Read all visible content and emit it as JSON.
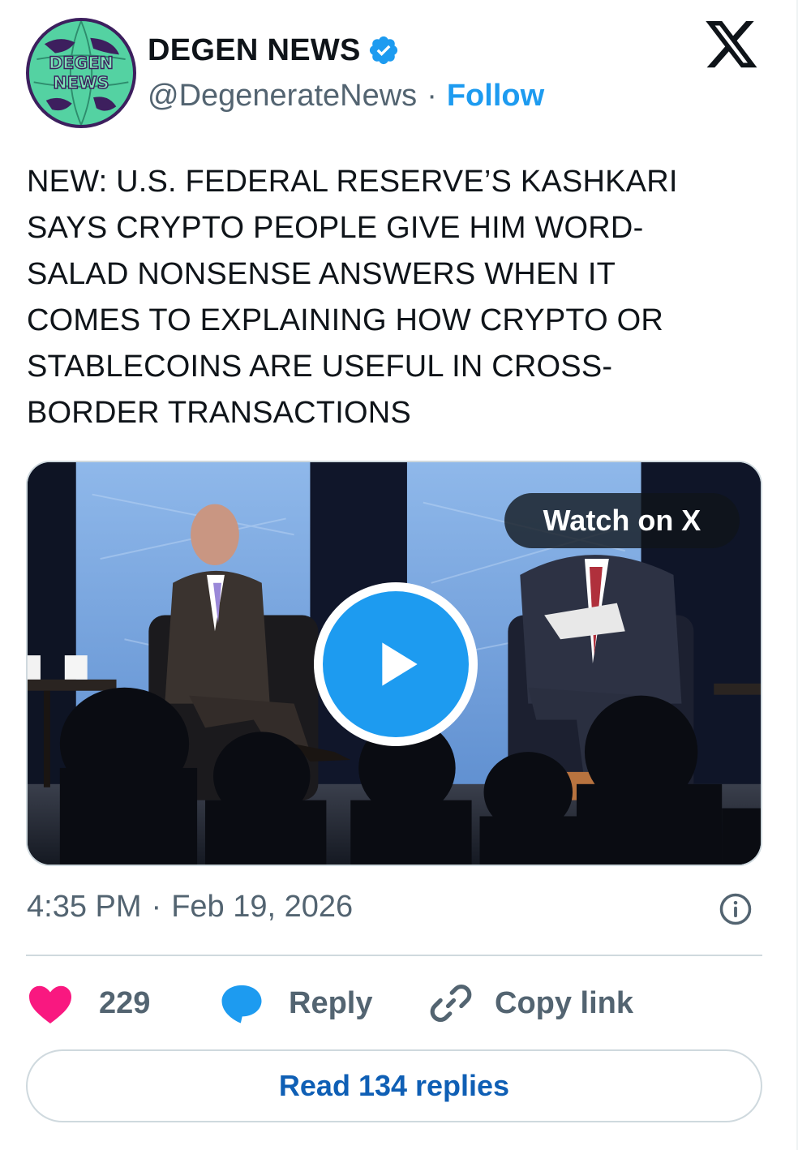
{
  "author": {
    "display_name": "DEGEN NEWS",
    "handle": "@DegenerateNews",
    "separator": "·",
    "follow_label": "Follow",
    "avatar_text_line1": "DEGEN",
    "avatar_text_line2": "NEWS",
    "verified": true
  },
  "tweet": {
    "text": "NEW: U.S. FEDERAL RESERVE’S KASHKARI SAYS CRYPTO PEOPLE GIVE HIM WORD-SALAD NONSENSE ANSWERS WHEN IT COMES TO EXPLAINING HOW CRYPTO OR STABLECOINS ARE USEFUL IN CROSS-BORDER TRANSACTIONS",
    "text_lines": [
      "NEW: U.S. FEDERAL RESERVE’S KASHKARI",
      "SAYS CRYPTO PEOPLE GIVE HIM WORD-",
      "SALAD NONSENSE ANSWERS WHEN IT",
      "COMES TO EXPLAINING HOW CRYPTO OR",
      "STABLECOINS ARE USEFUL IN CROSS-",
      "BORDER TRANSACTIONS"
    ]
  },
  "media": {
    "watch_label": "Watch on X",
    "type": "video"
  },
  "meta": {
    "time": "4:35 PM",
    "separator": "·",
    "date": "Feb 19, 2026"
  },
  "actions": {
    "likes": "229",
    "reply_label": "Reply",
    "copy_label": "Copy link"
  },
  "read_replies_label": "Read 134 replies",
  "colors": {
    "accent": "#1d9bf0",
    "like": "#f91880",
    "text": "#0f1419",
    "muted": "#536471",
    "border": "#cfd9de"
  },
  "icons": {
    "verified": "verified-badge-icon",
    "brand": "x-logo-icon",
    "info": "info-icon",
    "like": "heart-icon",
    "reply": "speech-bubble-icon",
    "copy": "link-icon",
    "play": "play-icon"
  }
}
